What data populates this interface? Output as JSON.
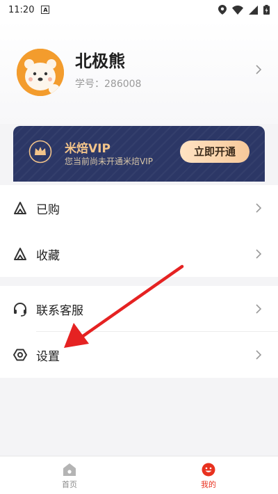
{
  "status_bar": {
    "time": "11:20",
    "notification_icon": "a-icon",
    "icons": [
      "location-icon",
      "wifi-icon",
      "signal-icon",
      "battery-icon"
    ]
  },
  "profile": {
    "name": "北极熊",
    "student_label": "学号：",
    "student_id": "286008"
  },
  "vip": {
    "title": "米焙VIP",
    "subtitle": "您当前尚未开通米焙VIP",
    "button_label": "立即开通"
  },
  "menu": {
    "group1": [
      {
        "label": "已购",
        "icon": "purchased-icon"
      },
      {
        "label": "收藏",
        "icon": "favorite-icon"
      }
    ],
    "group2": [
      {
        "label": "联系客服",
        "icon": "headset-icon"
      },
      {
        "label": "设置",
        "icon": "settings-icon"
      }
    ]
  },
  "tabbar": {
    "home_label": "首页",
    "mine_label": "我的"
  },
  "colors": {
    "vip_bg": "#2c3766",
    "vip_gold": "#f3c48a",
    "active_tab": "#e8311f",
    "arrow": "#e52222"
  }
}
